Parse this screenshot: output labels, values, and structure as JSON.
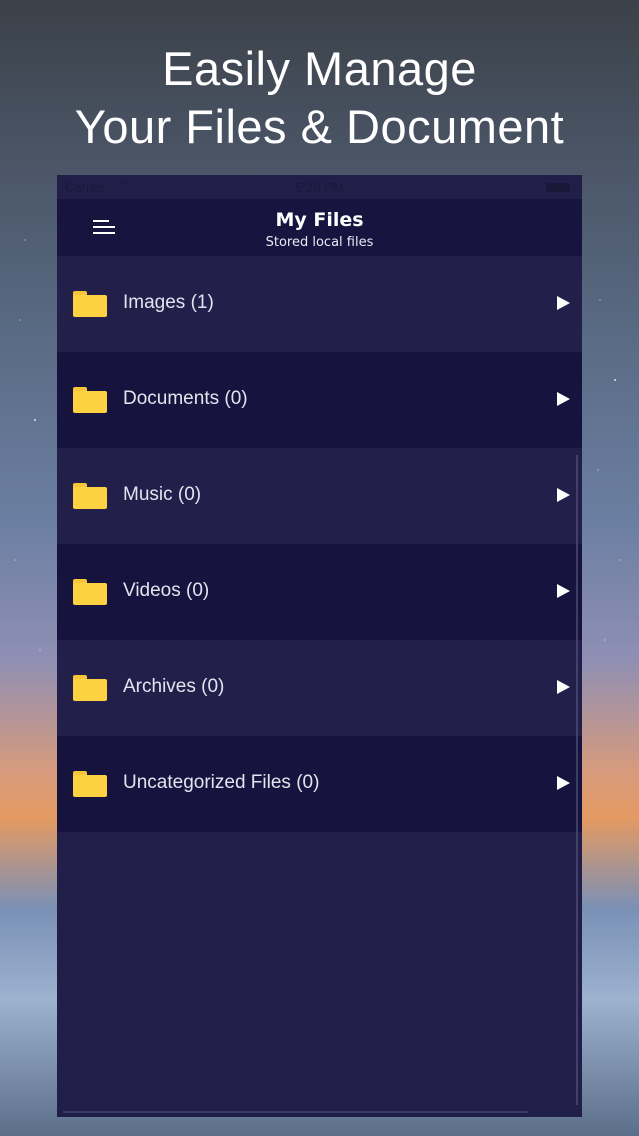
{
  "hero": {
    "line1": "Easily Manage",
    "line2": "Your Files & Document"
  },
  "statusbar": {
    "carrier": "Carrier",
    "time": "5:28 PM"
  },
  "navbar": {
    "title": "My Files",
    "subtitle": "Stored local files"
  },
  "folders": [
    {
      "label": "Images (1)"
    },
    {
      "label": "Documents (0)"
    },
    {
      "label": "Music (0)"
    },
    {
      "label": "Videos (0)"
    },
    {
      "label": "Archives (0)"
    },
    {
      "label": "Uncategorized Files (0)"
    }
  ],
  "colors": {
    "panel_bg": "#211f4a",
    "navbar_bg": "#17153f",
    "folder_yellow": "#fcd242",
    "text_white": "#ffffff"
  },
  "icons": {
    "menu": "menu-icon",
    "folder": "folder-icon",
    "chevron": "chevron-right-icon",
    "wifi": "wifi-icon",
    "battery": "battery-icon"
  }
}
